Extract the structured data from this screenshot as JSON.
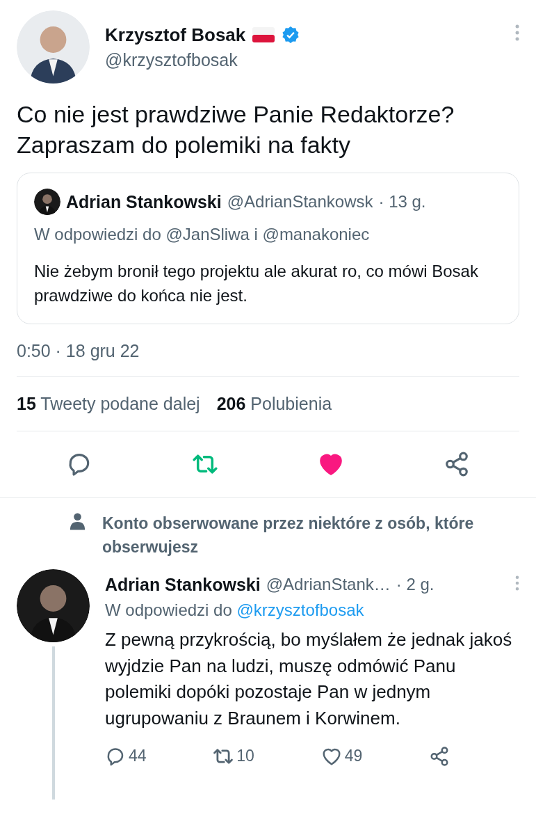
{
  "tweet": {
    "author": {
      "name": "Krzysztof Bosak",
      "handle": "@krzysztofbosak",
      "verified": true
    },
    "text": "Co nie jest prawdziwe Panie Redaktorze? Zapraszam do polemiki na fakty",
    "quote": {
      "name": "Adrian Stankowski",
      "handle": "@AdrianStankowsk",
      "time": "· 13 g.",
      "reply_to": "W odpowiedzi do @JanSliwa i @manakoniec",
      "text": "Nie żebym bronił tego projektu ale akurat ro, co mówi Bosak prawdziwe do końca nie jest."
    },
    "timestamp": "0:50 · 18 gru 22",
    "stats": [
      {
        "count": "15",
        "label": "Tweety podane dalej"
      },
      {
        "count": "206",
        "label": "Polubienia"
      }
    ],
    "actions": [
      {
        "kind": "reply",
        "active": false
      },
      {
        "kind": "retweet",
        "active": true
      },
      {
        "kind": "like",
        "active": true
      },
      {
        "kind": "share",
        "active": false
      }
    ]
  },
  "social_context": "Konto obserwowane przez niektóre z osób, które obserwujesz",
  "reply": {
    "name": "Adrian Stankowski",
    "handle": "@AdrianStank…",
    "time": "· 2 g.",
    "reply_prefix": "W odpowiedzi do",
    "reply_to": "@krzysztofbosak",
    "text": "Z pewną przykrością, bo myślałem że jednak jakoś wyjdzie Pan na ludzi, muszę odmówić Panu polemiki dopóki pozostaje Pan w jednym ugrupowaniu z Braunem i Korwinem.",
    "actions": [
      {
        "kind": "reply",
        "count": "44",
        "active": false
      },
      {
        "kind": "retweet",
        "count": "10",
        "active": false
      },
      {
        "kind": "like",
        "count": "49",
        "active": false
      },
      {
        "kind": "share",
        "active": false
      }
    ]
  }
}
